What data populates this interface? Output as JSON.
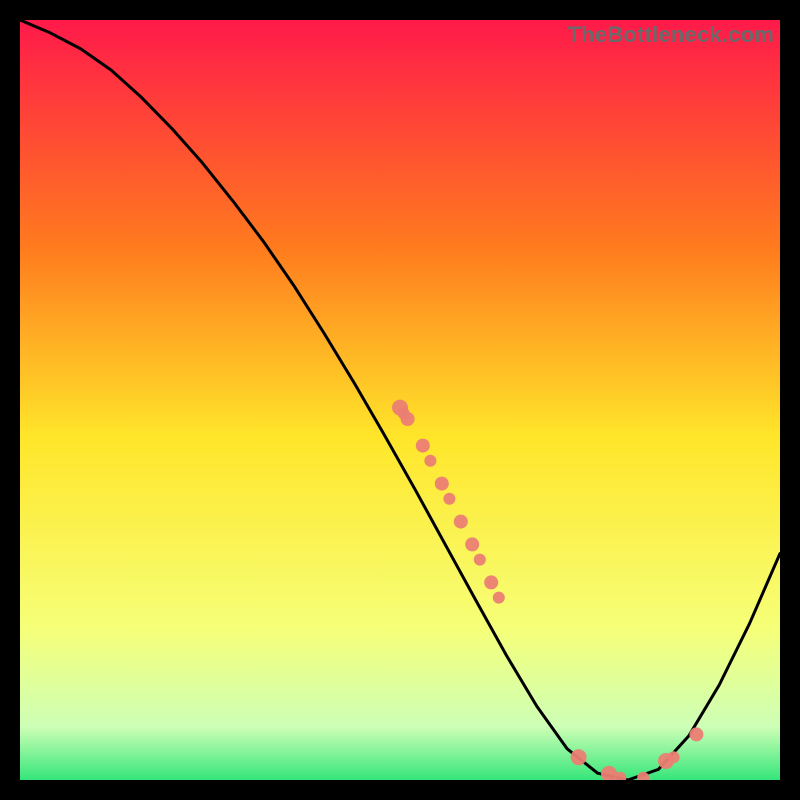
{
  "watermark": "TheBottleneck.com",
  "colors": {
    "background": "#000000",
    "curve": "#000000",
    "marker": "#eb7e73",
    "gradient_top": "#ff1a4a",
    "gradient_mid_top": "#ff7b1e",
    "gradient_mid": "#ffe62a",
    "gradient_mid_bottom": "#f6ff78",
    "gradient_bottom_a": "#cdffb6",
    "gradient_bottom": "#35e67a"
  },
  "chart_data": {
    "type": "line",
    "title": "",
    "xlabel": "",
    "ylabel": "",
    "xlim": [
      0,
      100
    ],
    "ylim": [
      0,
      100
    ],
    "curve": {
      "x": [
        0,
        4,
        8,
        12,
        16,
        20,
        24,
        28,
        32,
        36,
        40,
        44,
        48,
        52,
        56,
        60,
        64,
        68,
        72,
        76,
        80,
        84,
        88,
        92,
        96,
        100
      ],
      "y": [
        100,
        98.3,
        96.2,
        93.4,
        89.8,
        85.7,
        81.2,
        76.2,
        70.9,
        65.1,
        58.8,
        52.2,
        45.3,
        38.2,
        30.9,
        23.6,
        16.4,
        9.7,
        4.1,
        0.9,
        0.0,
        1.4,
        5.8,
        12.5,
        20.6,
        29.8
      ]
    },
    "markers": [
      {
        "x": 50.0,
        "y": 49.0,
        "r": 8
      },
      {
        "x": 50.5,
        "y": 48.2,
        "r": 6
      },
      {
        "x": 51.0,
        "y": 47.5,
        "r": 7
      },
      {
        "x": 53.0,
        "y": 44.0,
        "r": 7
      },
      {
        "x": 54.0,
        "y": 42.0,
        "r": 6
      },
      {
        "x": 55.5,
        "y": 39.0,
        "r": 7
      },
      {
        "x": 56.5,
        "y": 37.0,
        "r": 6
      },
      {
        "x": 58.0,
        "y": 34.0,
        "r": 7
      },
      {
        "x": 59.5,
        "y": 31.0,
        "r": 7
      },
      {
        "x": 60.5,
        "y": 29.0,
        "r": 6
      },
      {
        "x": 62.0,
        "y": 26.0,
        "r": 7
      },
      {
        "x": 63.0,
        "y": 24.0,
        "r": 6
      },
      {
        "x": 73.5,
        "y": 3.0,
        "r": 8
      },
      {
        "x": 77.5,
        "y": 0.8,
        "r": 8
      },
      {
        "x": 79.0,
        "y": 0.3,
        "r": 6
      },
      {
        "x": 82.0,
        "y": 0.3,
        "r": 6
      },
      {
        "x": 85.0,
        "y": 2.5,
        "r": 8
      },
      {
        "x": 86.0,
        "y": 3.0,
        "r": 6
      },
      {
        "x": 89.0,
        "y": 6.0,
        "r": 7
      }
    ]
  }
}
